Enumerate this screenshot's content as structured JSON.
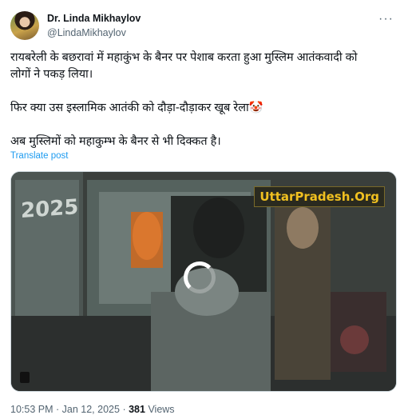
{
  "author": {
    "display_name": "Dr. Linda Mikhaylov",
    "handle": "@LindaMikhaylov"
  },
  "more_icon": "more-horizontal-icon",
  "tweet": {
    "line1": "रायबरेली के बछरावां में महाकुंभ के बैनर पर पेशाब करता हुआ मुस्लिम आतंकवादी को",
    "line2": "लोगों ने पकड़ लिया।",
    "line3": "फिर क्या उस इस्लामिक आतंकी को दौड़ा-दौड़ाकर खूब रेला🤡",
    "line4": "अब मुस्लिमों को महाकुम्भ के बैनर से भी दिक्कत है।"
  },
  "translate_label": "Translate post",
  "media": {
    "watermark": "UttarPradesh.Org",
    "banner_text": "2025",
    "spinner_icon": "loading-spinner-icon"
  },
  "meta": {
    "time": "10:53 PM",
    "separator": "·",
    "date": "Jan 12, 2025",
    "views_count": "381",
    "views_label": "Views"
  },
  "colors": {
    "accent": "#1d9bf0",
    "muted": "#536471",
    "text": "#0f1419"
  }
}
